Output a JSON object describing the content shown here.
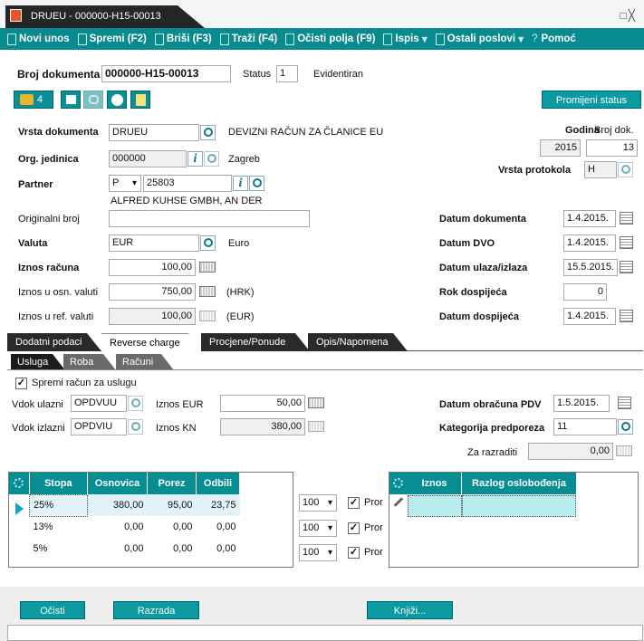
{
  "window": {
    "title": "DRUEU - 000000-H15-00013",
    "controls": "□╳"
  },
  "toolbar": [
    {
      "label": "Novi unos"
    },
    {
      "label": "Spremi (F2)"
    },
    {
      "label": "Briši (F3)"
    },
    {
      "label": "Traži (F4)"
    },
    {
      "label": "Očisti polja (F9)"
    },
    {
      "label": "Ispis",
      "dropdown": "▾"
    },
    {
      "label": "Ostali poslovi",
      "dropdown": "▾"
    },
    {
      "label": "Pomoć",
      "prefix": "?"
    }
  ],
  "header": {
    "doc_label": "Broj dokumenta",
    "doc_value": "000000-H15-00013",
    "status_label": "Status",
    "status_code": "1",
    "status_text": "Evidentiran",
    "change_status": "Promijeni status",
    "attach_count": "4"
  },
  "form": {
    "vrsta_label": "Vrsta dokumenta",
    "vrsta_value": "DRUEU",
    "vrsta_desc": "DEVIZNI RAČUN ZA ČLANICE EU",
    "org_label": "Org. jedinica",
    "org_value": "000000",
    "org_desc": "Zagreb",
    "partner_label": "Partner",
    "partner_type": "P",
    "partner_value": "25803",
    "partner_name": "ALFRED KUHSE GMBH, AN DER",
    "orig_label": "Originalni broj",
    "orig_value": "",
    "valuta_label": "Valuta",
    "valuta_value": "EUR",
    "valuta_desc": "Euro",
    "iznos_label": "Iznos računa",
    "iznos_value": "100,00",
    "osn_label": "Iznos u osn. valuti",
    "osn_value": "750,00",
    "osn_cur": "(HRK)",
    "ref_label": "Iznos u ref. valuti",
    "ref_value": "100,00",
    "ref_cur": "(EUR)",
    "godina_label": "Godina",
    "godina_value": "2015",
    "broj_label": "Broj dok.",
    "broj_value": "13",
    "protokol_label": "Vrsta protokola",
    "protokol_value": "H",
    "datum_dok_label": "Datum dokumenta",
    "datum_dok": "1.4.2015.",
    "dvo_label": "Datum DVO",
    "dvo": "1.4.2015.",
    "ulaz_label": "Datum ulaza/izlaza",
    "ulaz": "15.5.2015.",
    "rok_label": "Rok dospijeća",
    "rok": "0",
    "dosp_label": "Datum dospijeća",
    "dosp": "1.4.2015."
  },
  "tabs": [
    "Dodatni podaci",
    "Reverse charge",
    "Procjene/Ponude",
    "Opis/Napomena"
  ],
  "subtabs": [
    "Usluga",
    "Roba",
    "Računi"
  ],
  "rc": {
    "spremi_label": "Spremi račun za uslugu",
    "vdok_ul_label": "Vdok ulazni",
    "vdok_ul": "OPDVUU",
    "iznos_eur_label": "Iznos EUR",
    "iznos_eur": "50,00",
    "vdok_iz_label": "Vdok izlazni",
    "vdok_iz": "OPDVIU",
    "iznos_kn_label": "Iznos KN",
    "iznos_kn": "380,00",
    "datum_pdv_label": "Datum obračuna PDV",
    "datum_pdv": "1.5.2015.",
    "kat_label": "Kategorija predporeza",
    "kat": "11",
    "razraditi_label": "Za razraditi",
    "razraditi": "0,00"
  },
  "grid": {
    "headers": [
      "Stopa",
      "Osnovica",
      "Porez",
      "Odbili"
    ],
    "rows": [
      {
        "stopa": "25%",
        "osnovica": "380,00",
        "porez": "95,00",
        "odbili": "23,75",
        "pct": "100",
        "pror": "Pror"
      },
      {
        "stopa": "13%",
        "osnovica": "0,00",
        "porez": "0,00",
        "odbili": "0,00",
        "pct": "100",
        "pror": "Pror"
      },
      {
        "stopa": "5%",
        "osnovica": "0,00",
        "porez": "0,00",
        "odbili": "0,00",
        "pct": "100",
        "pror": "Pror"
      }
    ]
  },
  "grid2": {
    "headers": [
      "Iznos",
      "Razlog oslobođenja"
    ]
  },
  "buttons": {
    "ocisti": "Očisti",
    "razrada": "Razrada",
    "knjizi": "Knjiži..."
  }
}
